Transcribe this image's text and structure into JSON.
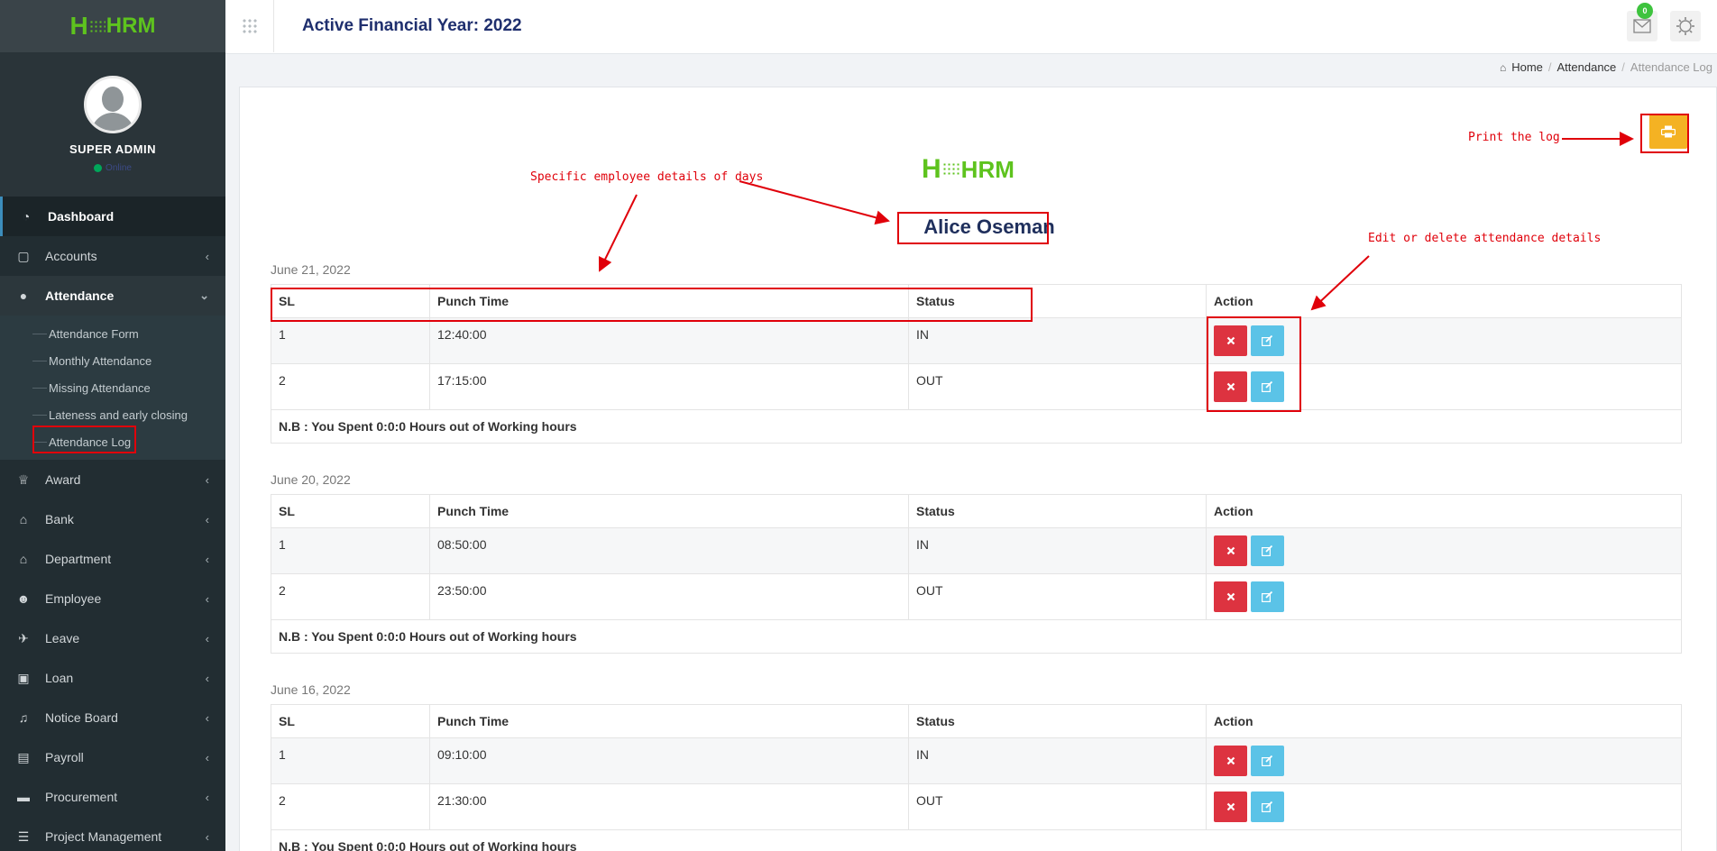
{
  "app": {
    "logo_text": "HRM"
  },
  "sidebar": {
    "user_name": "SUPER ADMIN",
    "status": "Online",
    "menu": [
      {
        "label": "Dashboard",
        "icon": "dashboard-icon"
      },
      {
        "label": "Accounts",
        "icon": "accounts-icon"
      },
      {
        "label": "Attendance",
        "icon": "user-icon"
      },
      {
        "label": "Award",
        "icon": "trophy-icon"
      },
      {
        "label": "Bank",
        "icon": "bank-icon"
      },
      {
        "label": "Department",
        "icon": "bank-icon"
      },
      {
        "label": "Employee",
        "icon": "users-icon"
      },
      {
        "label": "Leave",
        "icon": "plane-icon"
      },
      {
        "label": "Loan",
        "icon": "money-icon"
      },
      {
        "label": "Notice Board",
        "icon": "bell-icon"
      },
      {
        "label": "Payroll",
        "icon": "credit-card-icon"
      },
      {
        "label": "Procurement",
        "icon": "truck-icon"
      },
      {
        "label": "Project Management",
        "icon": "tasks-icon"
      }
    ],
    "attendance_submenu": [
      "Attendance Form",
      "Monthly Attendance",
      "Missing Attendance",
      "Lateness and early closing",
      "Attendance Log"
    ]
  },
  "topbar": {
    "title": "Active Financial Year: 2022",
    "mail_count": "0"
  },
  "breadcrumb": {
    "home": "Home",
    "section": "Attendance",
    "current": "Attendance Log"
  },
  "employee_name": "Alice Oseman",
  "table_headers": {
    "sl": "SL",
    "punch_time": "Punch Time",
    "status": "Status",
    "action": "Action"
  },
  "days": [
    {
      "date": "June 21, 2022",
      "rows": [
        {
          "sl": "1",
          "punch_time": "12:40:00",
          "status": "IN"
        },
        {
          "sl": "2",
          "punch_time": "17:15:00",
          "status": "OUT"
        }
      ],
      "note": "N.B : You Spent 0:0:0 Hours out of Working hours"
    },
    {
      "date": "June 20, 2022",
      "rows": [
        {
          "sl": "1",
          "punch_time": "08:50:00",
          "status": "IN"
        },
        {
          "sl": "2",
          "punch_time": "23:50:00",
          "status": "OUT"
        }
      ],
      "note": "N.B : You Spent 0:0:0 Hours out of Working hours"
    },
    {
      "date": "June 16, 2022",
      "rows": [
        {
          "sl": "1",
          "punch_time": "09:10:00",
          "status": "IN"
        },
        {
          "sl": "2",
          "punch_time": "21:30:00",
          "status": "OUT"
        }
      ],
      "note": "N.B : You Spent 0:0:0 Hours out of Working hours"
    }
  ],
  "annotations": {
    "print": "Print the log",
    "specific": "Specific employee details of days",
    "edit_delete": "Edit or delete attendance details"
  },
  "colors": {
    "sidebar_bg": "#222d32",
    "brand_green": "#5ec31e",
    "title_blue": "#1f2f6e",
    "print_btn": "#f4b223",
    "delete_btn": "#dd3340",
    "edit_btn": "#5bc3e7",
    "annotation_red": "#e0000a"
  }
}
